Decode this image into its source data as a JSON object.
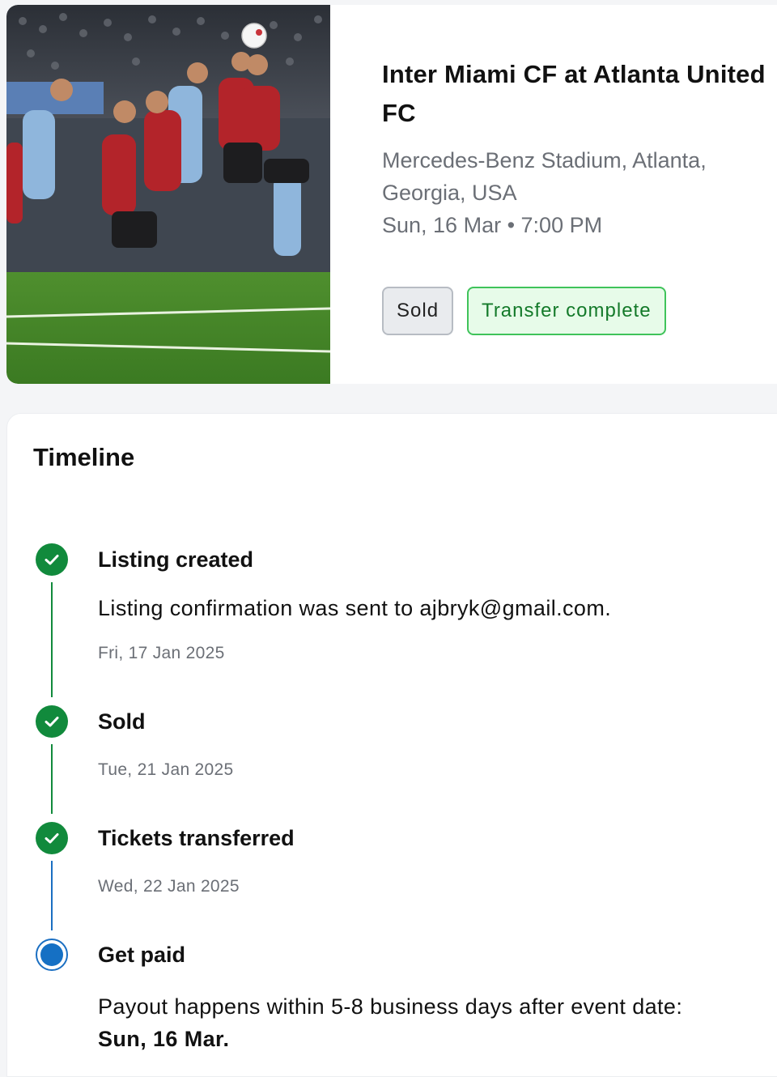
{
  "event": {
    "image_alt": "Soccer players competing for a header",
    "title": "Inter Miami CF at Atlanta United FC",
    "venue": "Mercedes-Benz Stadium, Atlanta, Georgia, USA",
    "datetime": "Sun, 16 Mar • 7:00 PM",
    "badges": {
      "sold": "Sold",
      "transfer": "Transfer complete"
    }
  },
  "timeline": {
    "heading": "Timeline",
    "steps": [
      {
        "title": "Listing created",
        "description": "Listing confirmation was sent to ajbryk@gmail.com.",
        "date": "Fri, 17 Jan 2025",
        "status": "done"
      },
      {
        "title": "Sold",
        "date": "Tue, 21 Jan 2025",
        "status": "done"
      },
      {
        "title": "Tickets transferred",
        "date": "Wed, 22 Jan 2025",
        "status": "done"
      },
      {
        "title": "Get paid",
        "description_prefix": "Payout happens within 5-8 business days after event date: ",
        "description_strong": "Sun, 16 Mar.",
        "status": "current"
      }
    ]
  },
  "colors": {
    "done": "#118a3c",
    "current": "#1570c4",
    "transfer_badge_border": "#3fc35a",
    "transfer_badge_text": "#147a2a"
  },
  "icons": {
    "done_marker": "check-circle-icon",
    "current_marker": "radio-dot-icon"
  }
}
